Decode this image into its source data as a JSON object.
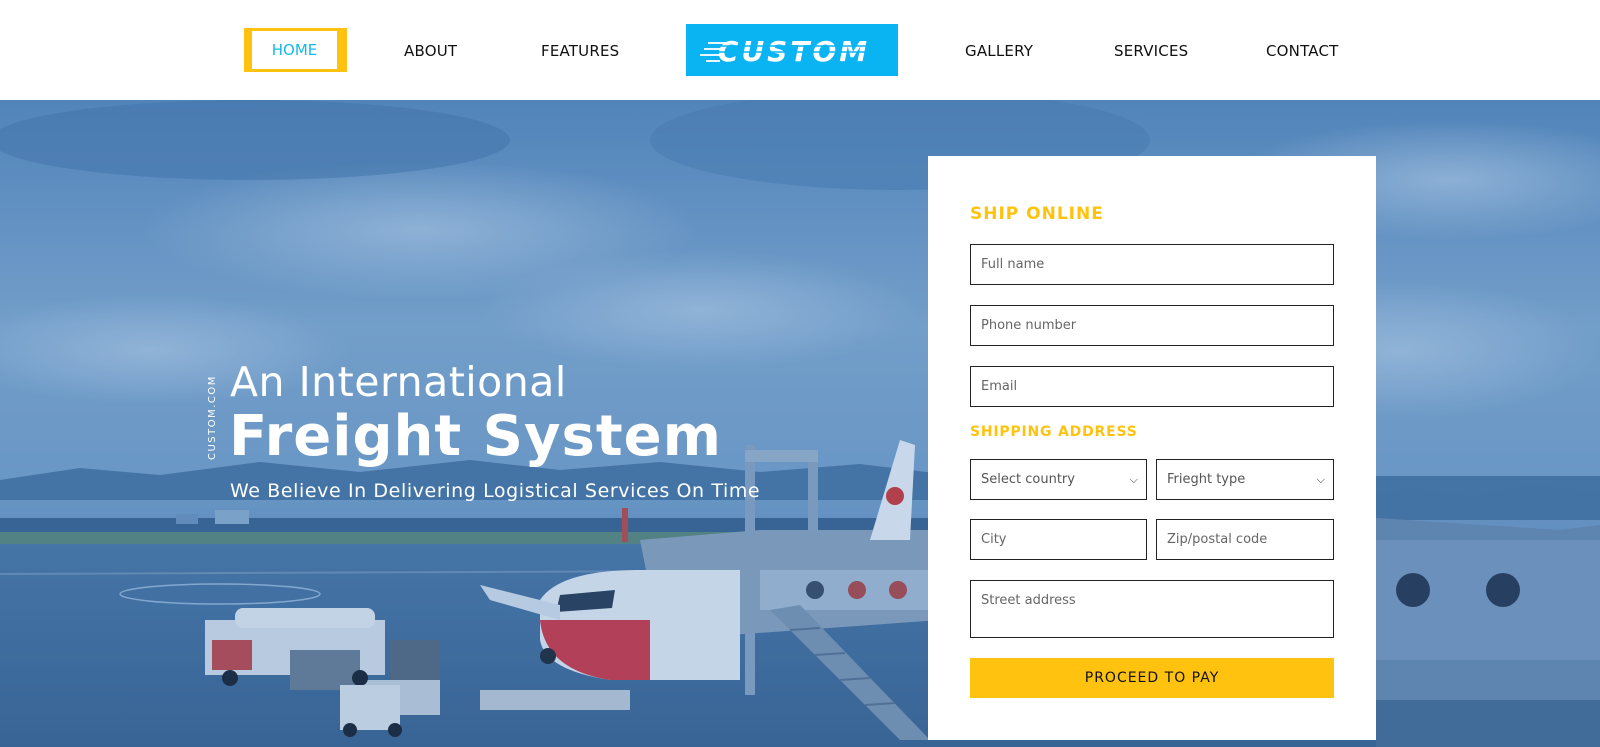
{
  "nav": {
    "items": [
      {
        "label": "HOME"
      },
      {
        "label": "ABOUT"
      },
      {
        "label": "FEATURES"
      },
      {
        "label": "GALLERY"
      },
      {
        "label": "SERVICES"
      },
      {
        "label": "CONTACT"
      }
    ],
    "logo_text": "CUSTOM",
    "active_color": "#14b9ea",
    "accent_color": "#ffc30f",
    "logo_bg": "#0ab4f2"
  },
  "hero": {
    "side_text": "CUSTOM.COM",
    "line1": "An International",
    "line2": "Freight System",
    "tagline": "We Believe In Delivering Logistical Services On Time"
  },
  "form": {
    "title": "SHIP ONLINE",
    "fullname_placeholder": "Full name",
    "phone_placeholder": "Phone number",
    "email_placeholder": "Email",
    "address_section": "SHIPPING ADDRESS",
    "country_selected": "Select country",
    "freight_selected": "Frieght type",
    "city_placeholder": "City",
    "zip_placeholder": "Zip/postal code",
    "street_placeholder": "Street address",
    "submit_label": "PROCEED TO PAY"
  }
}
